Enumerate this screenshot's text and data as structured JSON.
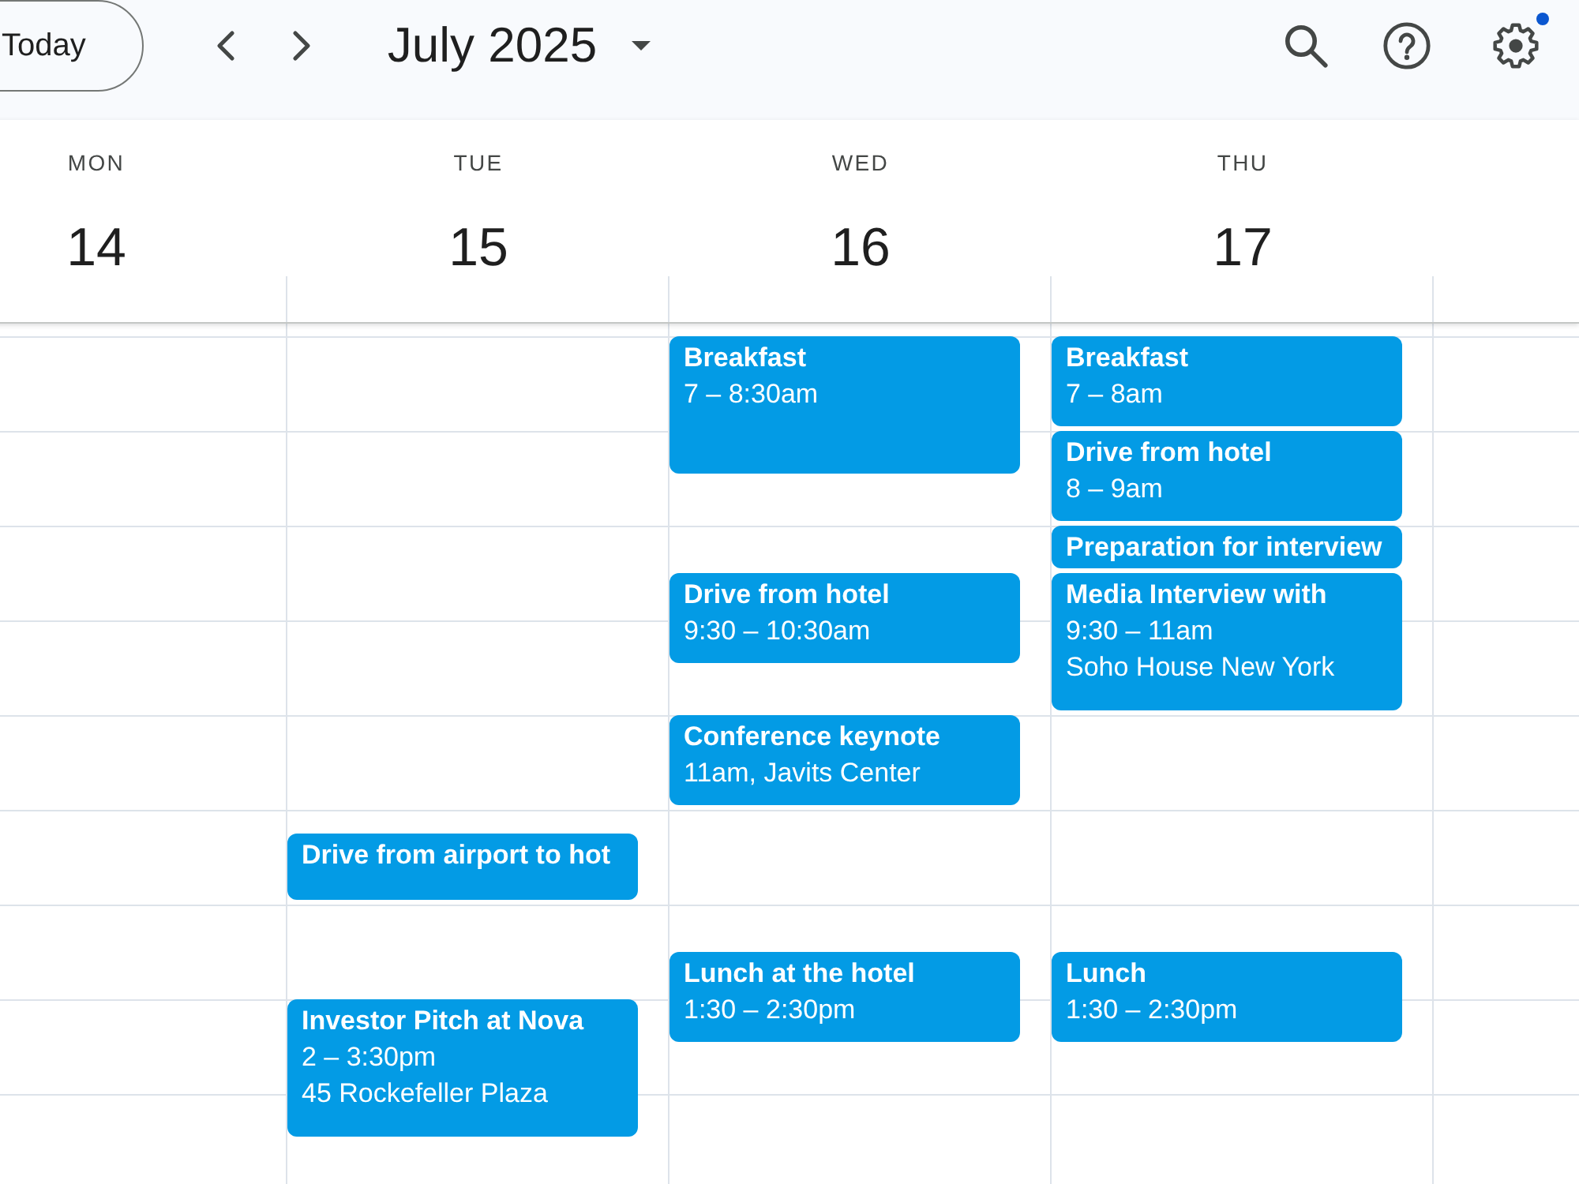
{
  "header": {
    "today_button": "Today",
    "title": "July 2025",
    "settings": {
      "badge": true
    }
  },
  "days": [
    {
      "name": "MON",
      "number": "14"
    },
    {
      "name": "TUE",
      "number": "15",
      "events": [
        {
          "title": "Drive from airport to hot"
        },
        {
          "title": "Investor Pitch at Nova",
          "details": [
            "2 – 3:30pm",
            "45 Rockefeller Plaza"
          ]
        }
      ]
    },
    {
      "name": "WED",
      "number": "16",
      "events": [
        {
          "title": "Breakfast",
          "details": [
            "7 – 8:30am"
          ]
        },
        {
          "title": "Drive from hotel",
          "details": [
            "9:30 – 10:30am"
          ]
        },
        {
          "title": "Conference keynote",
          "details": [
            "11am, Javits Center"
          ]
        },
        {
          "title": "Lunch at the hotel",
          "details": [
            "1:30 – 2:30pm"
          ]
        }
      ]
    },
    {
      "name": "THU",
      "number": "17",
      "events": [
        {
          "title": "Breakfast",
          "details": [
            "7 – 8am"
          ]
        },
        {
          "title": "Drive from hotel",
          "details": [
            "8 – 9am"
          ]
        },
        {
          "title": "Preparation for interview"
        },
        {
          "title": "Media Interview with",
          "details": [
            "9:30 – 11am",
            "Soho House New York"
          ]
        },
        {
          "title": "Lunch",
          "details": [
            "1:30 – 2:30pm"
          ]
        }
      ]
    }
  ]
}
